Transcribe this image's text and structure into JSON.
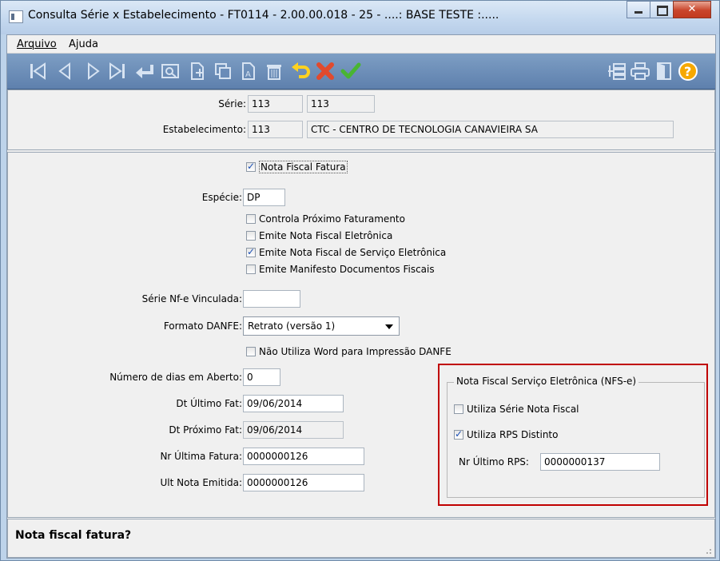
{
  "window": {
    "title": "Consulta Série x Estabelecimento - FT0114 - 2.00.00.018 - 25 - ....: BASE TESTE :....."
  },
  "menu": {
    "arquivo": "Arquivo",
    "ajuda": "Ajuda"
  },
  "header": {
    "serie_label": "Série:",
    "serie_code": "113",
    "serie_desc": "113",
    "estab_label": "Estabelecimento:",
    "estab_code": "113",
    "estab_desc": "CTC - CENTRO DE TECNOLOGIA CANAVIEIRA SA"
  },
  "form": {
    "nota_fiscal_fatura": {
      "label": "Nota Fiscal Fatura",
      "checked": true
    },
    "especie_label": "Espécie:",
    "especie_value": "DP",
    "checks": [
      {
        "label": "Controla Próximo Faturamento",
        "checked": false
      },
      {
        "label": "Emite Nota Fiscal Eletrônica",
        "checked": false
      },
      {
        "label": "Emite Nota Fiscal de Serviço Eletrônica",
        "checked": true
      },
      {
        "label": "Emite Manifesto Documentos Fiscais",
        "checked": false
      }
    ],
    "serie_nfe_label": "Série Nf-e Vinculada:",
    "serie_nfe_value": "",
    "formato_danfe_label": "Formato DANFE:",
    "formato_danfe_value": "Retrato (versão 1)",
    "nao_utiliza_word": {
      "label": "Não Utiliza Word para Impressão DANFE",
      "checked": false
    },
    "dias_aberto_label": "Número de dias em Aberto:",
    "dias_aberto_value": "0",
    "dt_ultimo_fat_label": "Dt Último Fat:",
    "dt_ultimo_fat_value": "09/06/2014",
    "dt_proximo_fat_label": "Dt Próximo Fat:",
    "dt_proximo_fat_value": "09/06/2014",
    "nr_ultima_fatura_label": "Nr Última Fatura:",
    "nr_ultima_fatura_value": "0000000126",
    "ult_nota_emitida_label": "Ult Nota Emitida:",
    "ult_nota_emitida_value": "0000000126"
  },
  "nfse": {
    "title": "Nota Fiscal Serviço Eletrônica (NFS-e)",
    "utiliza_serie": {
      "label": "Utiliza Série Nota Fiscal",
      "checked": false
    },
    "utiliza_rps": {
      "label": "Utiliza RPS Distinto",
      "checked": true
    },
    "nr_ultimo_rps_label": "Nr Último RPS:",
    "nr_ultimo_rps_value": "0000000137"
  },
  "status": {
    "text": "Nota fiscal fatura?"
  },
  "colors": {
    "toolbar": "#6a8cb8",
    "highlight": "#c00000",
    "close": "#c9452b"
  }
}
